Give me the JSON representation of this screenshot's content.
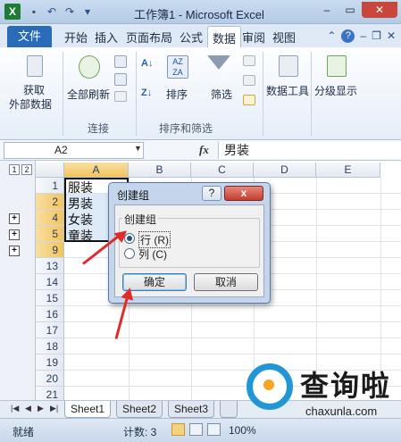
{
  "window": {
    "title": "工作簿1 - Microsoft Excel",
    "app_icon": "X"
  },
  "qat": {
    "icons": [
      "save-icon",
      "undo-icon",
      "redo-icon",
      "customize-icon"
    ]
  },
  "ribbon_tabs": [
    "文件",
    "开始",
    "插入",
    "页面布局",
    "公式",
    "数据",
    "审阅",
    "视图"
  ],
  "active_tab": "数据",
  "ribbon": {
    "get_external": "获取\n外部数据",
    "get_external_l1": "获取",
    "get_external_l2": "外部数据",
    "refresh_all": "全部刷新",
    "sort": "排序",
    "filter": "筛选",
    "data_tools": "数据工具",
    "outline": "分级显示",
    "group_connections": "连接",
    "group_sort_filter": "排序和筛选"
  },
  "formula_bar": {
    "name_box": "A2",
    "fx": "fx",
    "value": "男装"
  },
  "sheet": {
    "columns": [
      "A",
      "B",
      "C",
      "D",
      "E"
    ],
    "rows": [
      "1",
      "2",
      "3",
      "4",
      "5",
      "9",
      "13",
      "14",
      "15",
      "16",
      "17",
      "18",
      "19",
      "20",
      "21",
      "22"
    ],
    "row_labels": [
      "1",
      "2",
      "4",
      "5",
      "9",
      "13",
      "14",
      "15",
      "16",
      "17",
      "18",
      "19",
      "20",
      "21",
      "22"
    ],
    "cells": [
      "服装",
      "男装",
      "女装",
      "童装"
    ],
    "outline_levels": [
      "1",
      "2"
    ],
    "outline_buttons": [
      "+",
      "+",
      "+"
    ]
  },
  "dialog": {
    "title": "创建组",
    "help": "?",
    "close": "x",
    "group_label": "创建组",
    "option_rows": "行 (R)",
    "option_cols": "列 (C)",
    "ok": "确定",
    "cancel": "取消"
  },
  "sheet_tabs": [
    "Sheet1",
    "Sheet2",
    "Sheet3"
  ],
  "status": {
    "ready": "就绪",
    "count": "计数: 3",
    "zoom": "100%"
  },
  "watermark": {
    "text": "查询啦",
    "url": "chaxunla.com"
  }
}
